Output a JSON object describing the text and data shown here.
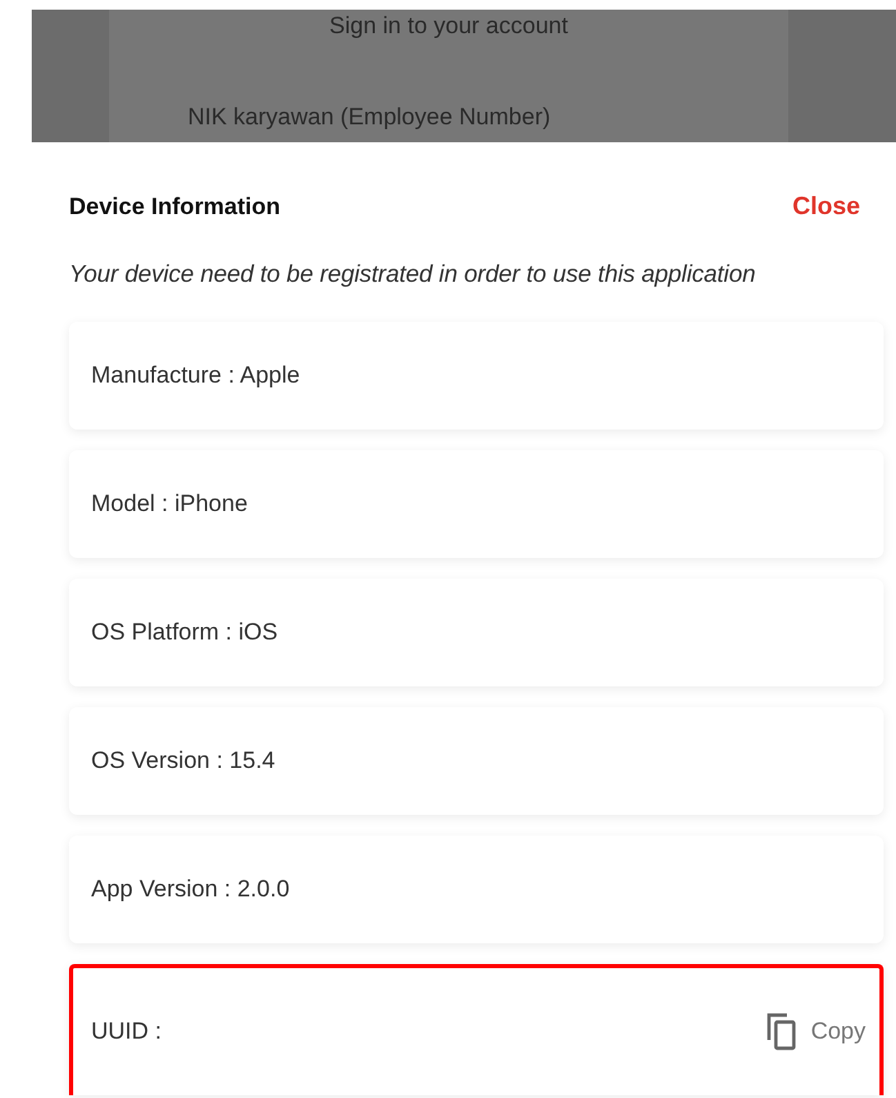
{
  "background": {
    "title": "Sign in to your account",
    "field_label": "NIK karyawan (Employee Number)"
  },
  "sheet": {
    "title": "Device Information",
    "close": "Close",
    "subtitle": "Your device need to be registrated in order to use this application",
    "items": [
      {
        "kind": "info",
        "label": "Manufacture : Apple",
        "highlighted": false
      },
      {
        "kind": "info",
        "label": "Model : iPhone",
        "highlighted": false
      },
      {
        "kind": "info",
        "label": "OS Platform : iOS",
        "highlighted": false
      },
      {
        "kind": "info",
        "label": "OS Version : 15.4",
        "highlighted": false
      },
      {
        "kind": "info",
        "label": "App Version : 2.0.0",
        "highlighted": false
      },
      {
        "kind": "copy",
        "label": "UUID :",
        "action": "Copy",
        "highlighted": true
      }
    ]
  }
}
